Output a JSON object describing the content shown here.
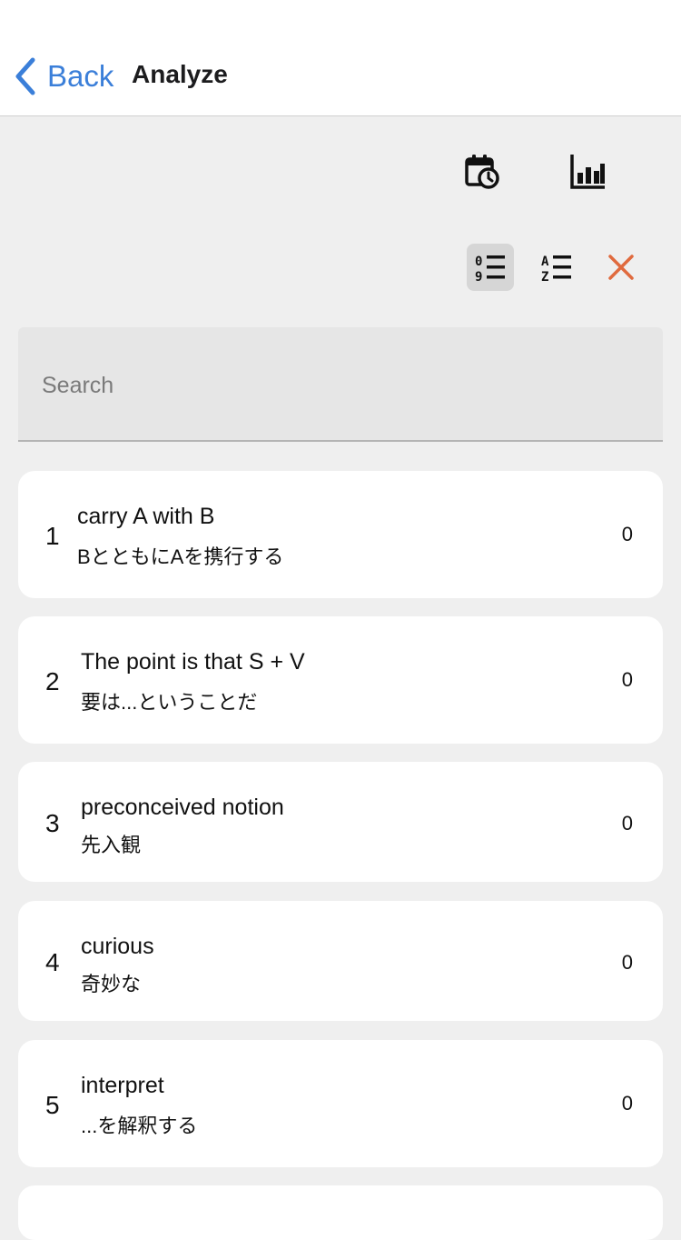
{
  "nav": {
    "back_label": "Back",
    "title": "Analyze"
  },
  "toolbar": {
    "history_icon": "calendar-clock-icon",
    "chart_icon": "bar-chart-icon",
    "sort_numeric_icon": "sort-numeric-icon",
    "sort_alpha_icon": "sort-alpha-icon",
    "close_icon": "close-icon",
    "close_color": "#e06a3e"
  },
  "search": {
    "placeholder": "Search",
    "value": ""
  },
  "items": [
    {
      "index": "1",
      "word": "carry A with B",
      "meaning": "BとともにAを携行する",
      "count": "0"
    },
    {
      "index": "2",
      "word": "The point is that S + V",
      "meaning": "要は...ということだ",
      "count": "0"
    },
    {
      "index": "3",
      "word": "preconceived notion",
      "meaning": "先入観",
      "count": "0"
    },
    {
      "index": "4",
      "word": "curious",
      "meaning": "奇妙な",
      "count": "0"
    },
    {
      "index": "5",
      "word": "interpret",
      "meaning": "...を解釈する",
      "count": "0"
    }
  ],
  "colors": {
    "accent": "#3b7fd9",
    "background": "#efefef",
    "card": "#ffffff"
  }
}
